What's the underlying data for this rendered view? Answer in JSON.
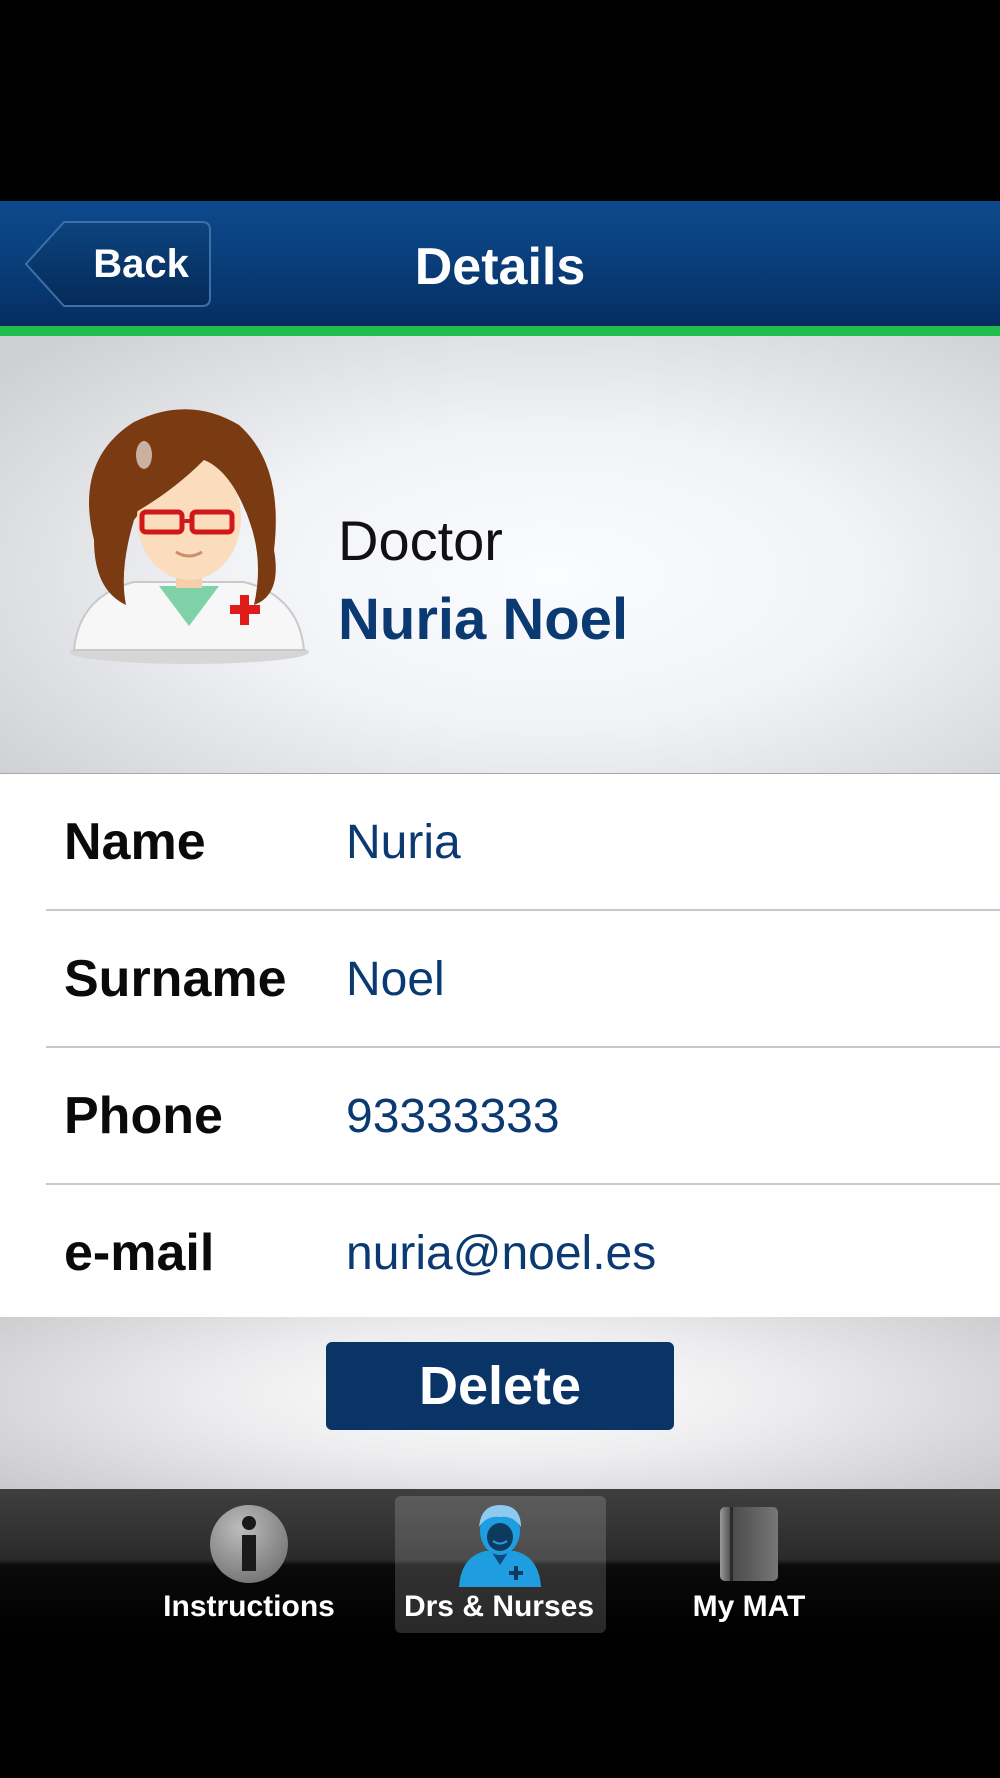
{
  "navbar": {
    "back_label": "Back",
    "title": "Details"
  },
  "profile": {
    "role": "Doctor",
    "full_name": "Nuria Noel"
  },
  "details": [
    {
      "label": "Name",
      "value": "Nuria"
    },
    {
      "label": "Surname",
      "value": "Noel"
    },
    {
      "label": "Phone",
      "value": "93333333"
    },
    {
      "label": "e-mail",
      "value": "nuria@noel.es"
    }
  ],
  "actions": {
    "delete_label": "Delete"
  },
  "tabbar": {
    "tabs": [
      {
        "label": "Instructions",
        "icon": "info-icon",
        "selected": false
      },
      {
        "label": "Drs & Nurses",
        "icon": "doctor-icon",
        "selected": true
      },
      {
        "label": "My MAT",
        "icon": "book-icon",
        "selected": false
      }
    ]
  },
  "colors": {
    "navbar": "#0a3f7c",
    "accent_green": "#1fbd4b",
    "value_text": "#0b3a72",
    "delete_button": "#0a3466"
  }
}
